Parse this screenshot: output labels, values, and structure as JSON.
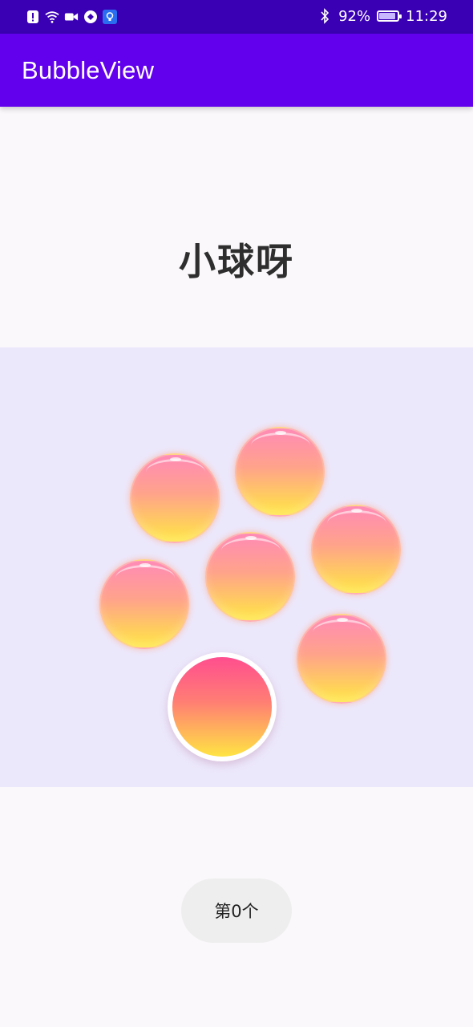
{
  "status_bar": {
    "time": "11:29",
    "battery_text": "92%",
    "battery_level": 0.92,
    "left_icons": [
      "alert-icon",
      "wifi-icon",
      "video-icon",
      "vpn-icon",
      "bulb-icon"
    ],
    "right_icons": [
      "bluetooth-icon",
      "battery-icon"
    ]
  },
  "app_bar": {
    "title": "BubbleView",
    "color": "#6200ee"
  },
  "main": {
    "heading": "小球呀",
    "bubble_count": 7,
    "counter_label": "第0个"
  },
  "colors": {
    "status_bar": "#3a00b3",
    "bubble_area": "#ece8fb",
    "bubble_top": "#ff8ab6",
    "bubble_bottom": "#ffe743",
    "main_bubble_top": "#ff4e8f"
  }
}
